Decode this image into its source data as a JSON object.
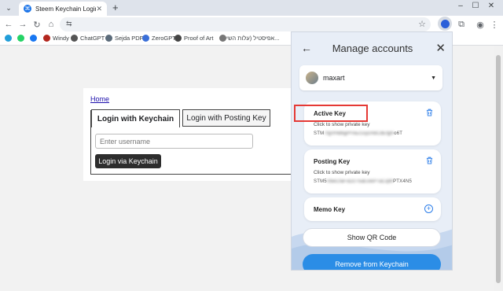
{
  "browser": {
    "tab_title": "Steem Keychain Login",
    "new_tab_label": "+",
    "bookmarks": [
      {
        "label": "",
        "color": "#229ed9"
      },
      {
        "label": "",
        "color": "#25d366"
      },
      {
        "label": "",
        "color": "#1877f2"
      },
      {
        "label": "Windy",
        "color": "#b3261e"
      },
      {
        "label": "ChatGPT",
        "color": "#555555"
      },
      {
        "label": "Sejda PDF",
        "color": "#5b6b7a"
      },
      {
        "label": "ZeroGPT",
        "color": "#3a6fd8"
      },
      {
        "label": "Proof of Art",
        "color": "#444444"
      },
      {
        "label": "...אפיסטיל (עלות השי",
        "color": "#777777"
      }
    ]
  },
  "page": {
    "home_link": "Home",
    "tab_active": "Login with Keychain",
    "tab_inactive": "Login with Posting Key",
    "username_placeholder": "Enter username",
    "login_button": "Login via Keychain"
  },
  "panel": {
    "title": "Manage accounts",
    "account_name": "maxart",
    "keys": [
      {
        "title": "Active Key",
        "hint": "Click to show private key",
        "value_prefix": "STM",
        "value_blurred": "7fgVHB6gPrVaJ1xyzAbCdEfgH",
        "value_suffix": "o6T"
      },
      {
        "title": "Posting Key",
        "hint": "Click to show private key",
        "value_prefix": "STM5",
        "value_blurred": "VbeCfaFoDzTtuBJxkPTaCqW",
        "value_suffix": "PTX4N5"
      },
      {
        "title": "Memo Key"
      }
    ],
    "qr_button": "Show QR Code",
    "remove_button": "Remove from Keychain"
  },
  "colors": {
    "accent": "#2b8de6",
    "highlight": "#e53935"
  }
}
